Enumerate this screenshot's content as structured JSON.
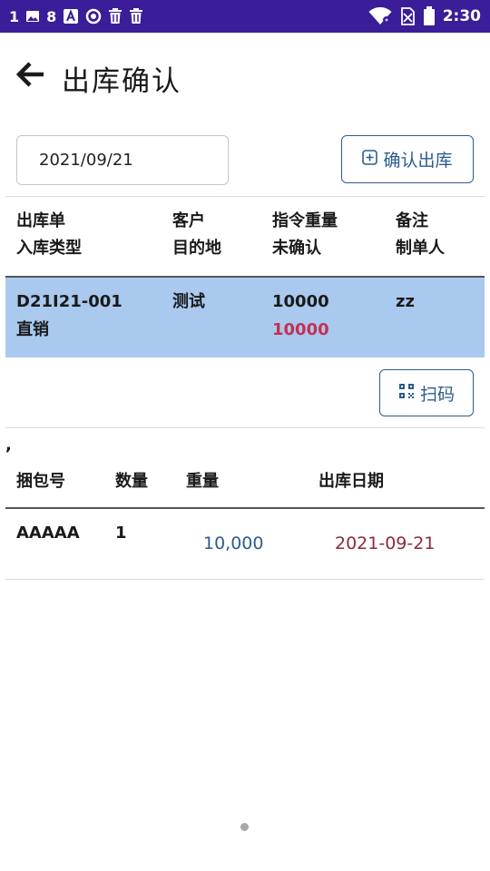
{
  "status_bar": {
    "left_text_1": "1",
    "left_text_2": "8",
    "time": "2:30",
    "icons": [
      "image-icon",
      "a-icon",
      "circle-icon",
      "trash-icon",
      "trash-icon",
      "wifi-icon",
      "no-sim-icon",
      "battery-icon"
    ]
  },
  "header": {
    "title": "出库确认",
    "back_icon": "arrow-left-icon"
  },
  "toolbar": {
    "date_value": "2021/09/21",
    "confirm_label": "确认出库",
    "confirm_icon": "plus-square-icon"
  },
  "order_table": {
    "headers": {
      "col1_line1": "出库单",
      "col1_line2": "入库类型",
      "col2_line1": "客户",
      "col2_line2": "目的地",
      "col3_line1": "指令重量",
      "col3_line2": "未确认",
      "col4_line1": "备注",
      "col4_line2": "制单人"
    },
    "row": {
      "order_no": "D21I21-001",
      "type": "直销",
      "customer": "测试",
      "weight": "10000",
      "unconfirmed": "10000",
      "remark": "zz"
    },
    "row_bg": "#a9c9ee",
    "alert_color": "#c43052"
  },
  "scan": {
    "label": "扫码",
    "icon": "qr-code-icon"
  },
  "separator_char": ",",
  "bundle_table": {
    "headers": {
      "bundle_no": "捆包号",
      "qty": "数量",
      "weight": "重量",
      "out_date": "出库日期"
    },
    "rows": [
      {
        "bundle_no": "AAAAA",
        "qty": "1",
        "weight": "10,000",
        "out_date": "2021-09-21"
      }
    ]
  },
  "colors": {
    "status_bar": "#3a1d99",
    "accent": "#2b5d8e",
    "date_text": "#8c2a3c"
  }
}
